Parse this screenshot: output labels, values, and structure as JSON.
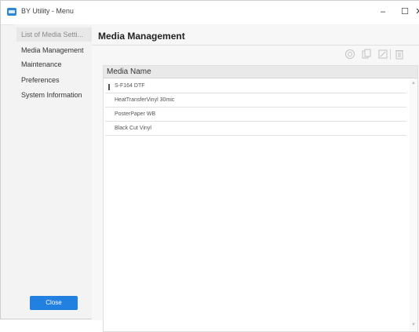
{
  "window": {
    "title": "BY Utility - Menu",
    "controls": {
      "minimize": "–",
      "maximize": "☐",
      "close": "✕"
    }
  },
  "sidebar": {
    "items": [
      {
        "label": "List of Media Setti...",
        "selected": true
      },
      {
        "label": "Media Management",
        "selected": false
      },
      {
        "label": "Maintenance",
        "selected": false
      },
      {
        "label": "Preferences",
        "selected": false
      },
      {
        "label": "System Information",
        "selected": false
      }
    ],
    "close_label": "Close"
  },
  "main": {
    "title": "Media Management",
    "toolbar_icons": [
      "new-icon",
      "copy-icon",
      "edit-icon",
      "delete-icon"
    ],
    "list": {
      "header": "Media Name",
      "rows": [
        "S-F164 DTF",
        "HeatTransferVinyl 30mic",
        "PosterPaper WB",
        "Black Cut Vinyl"
      ]
    }
  },
  "colors": {
    "accent": "#2180e0",
    "selected_bg": "#e8e8e8"
  }
}
